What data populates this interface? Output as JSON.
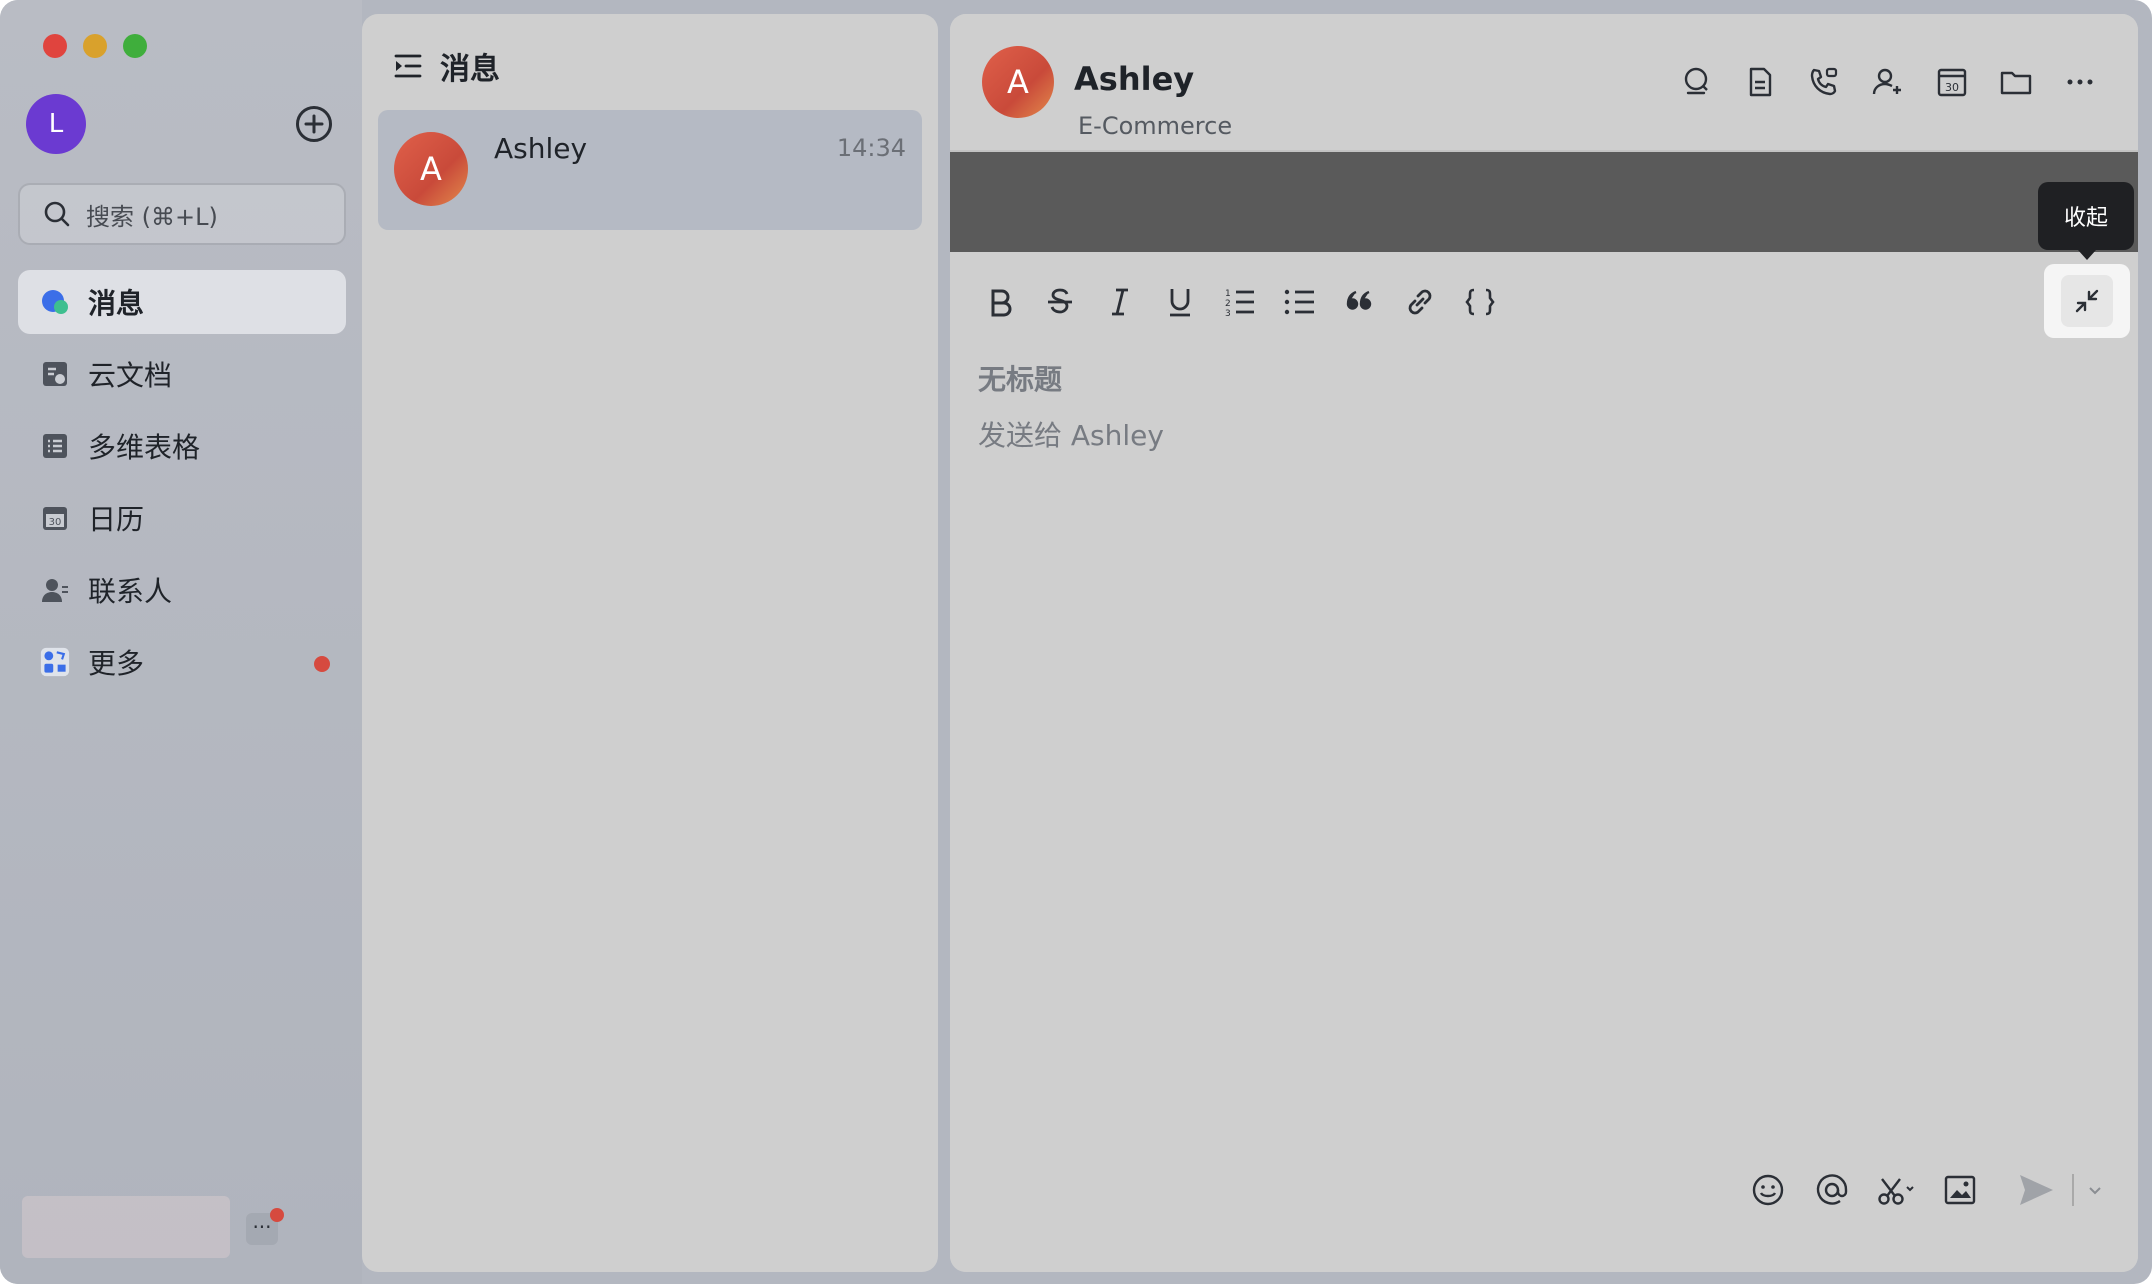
{
  "colors": {
    "accent_avatar_me": "#6b3ad1",
    "notification_dot": "#d64a3f",
    "avatar_gradient_start": "#e0604a",
    "avatar_gradient_end": "#e38b4c",
    "tooltip_bg": "#1f2023"
  },
  "sidebar": {
    "user_avatar_initial": "L",
    "search_placeholder": "搜索 (⌘+L)",
    "items": [
      {
        "label": "消息",
        "icon": "messages-icon",
        "active": true
      },
      {
        "label": "云文档",
        "icon": "docs-icon"
      },
      {
        "label": "多维表格",
        "icon": "base-table-icon"
      },
      {
        "label": "日历",
        "icon": "calendar-icon"
      },
      {
        "label": "联系人",
        "icon": "contacts-icon"
      },
      {
        "label": "更多",
        "icon": "more-apps-icon",
        "badge": true
      }
    ],
    "bottom_more": "···"
  },
  "conversation_list": {
    "title": "消息",
    "items": [
      {
        "avatar_initial": "A",
        "name": "Ashley",
        "time": "14:34"
      }
    ]
  },
  "chat": {
    "avatar_initial": "A",
    "name": "Ashley",
    "subtitle": "E-Commerce",
    "header_icons": [
      "search-icon",
      "doc-icon",
      "call-icon",
      "add-member-icon",
      "calendar-icon",
      "folder-icon",
      "more-icon"
    ]
  },
  "editor": {
    "toolbar": [
      "bold",
      "strikethrough",
      "italic",
      "underline",
      "ordered-list",
      "bullet-list",
      "quote",
      "link",
      "code-block"
    ],
    "tooltip": "收起",
    "title_placeholder": "无标题",
    "body_placeholder": "发送给 Ashley",
    "bottom_icons": [
      "emoji-icon",
      "mention-icon",
      "screenshot-icon",
      "image-icon",
      "send-icon"
    ]
  }
}
